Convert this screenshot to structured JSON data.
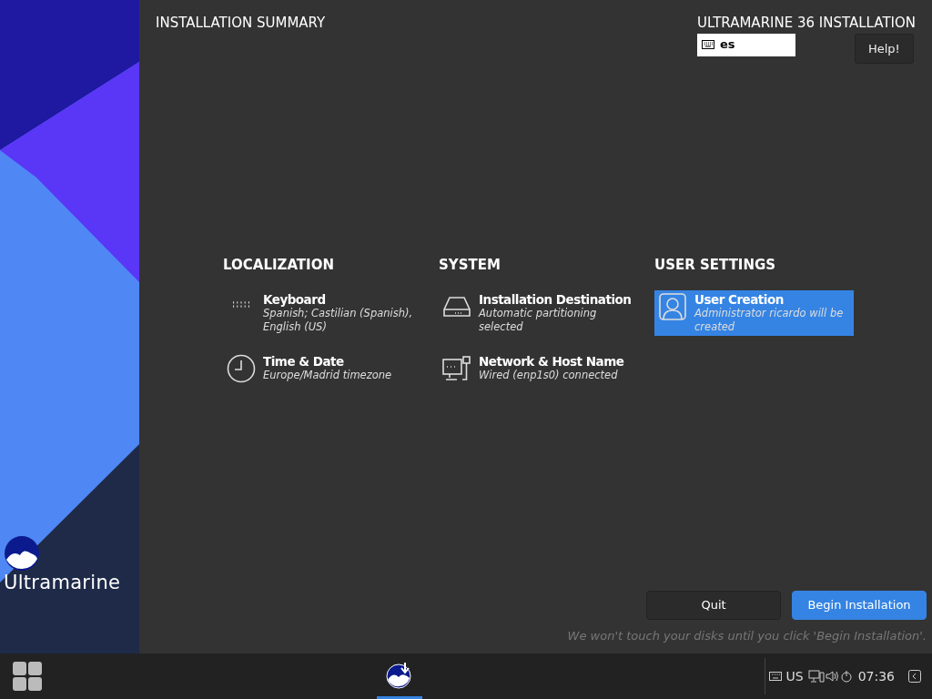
{
  "sidebar": {
    "logo_text": "Ultramarine"
  },
  "header": {
    "title": "INSTALLATION SUMMARY",
    "product": "ULTRAMARINE 36 INSTALLATION",
    "keyboard_layout": "es",
    "help_button": "Help!"
  },
  "sections": [
    {
      "title": "LOCALIZATION",
      "items": [
        {
          "kind": "keyboard",
          "title": "Keyboard",
          "status": "Spanish; Castilian (Spanish), English (US)",
          "selected": false
        },
        {
          "kind": "clock",
          "title": "Time & Date",
          "status": "Europe/Madrid timezone",
          "selected": false
        }
      ]
    },
    {
      "title": "SYSTEM",
      "items": [
        {
          "kind": "drive",
          "title": "Installation Destination",
          "status": "Automatic partitioning selected",
          "selected": false
        },
        {
          "kind": "network",
          "title": "Network & Host Name",
          "status": "Wired (enp1s0) connected",
          "selected": false
        }
      ]
    },
    {
      "title": "USER SETTINGS",
      "items": [
        {
          "kind": "user",
          "title": "User Creation",
          "status": "Administrator ricardo will be created",
          "selected": true
        }
      ]
    }
  ],
  "buttons": [
    {
      "label": "Quit",
      "primary": false
    },
    {
      "label": "Begin Installation",
      "primary": true
    }
  ],
  "note": "We won't touch your disks until you click 'Begin Installation'.",
  "taskbar": {
    "apps": [
      {
        "selected": true
      }
    ],
    "keyboard_layout": "US",
    "clock": "07:36"
  }
}
